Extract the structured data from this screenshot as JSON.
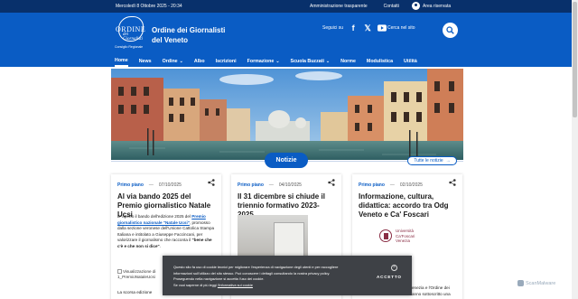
{
  "topbar": {
    "date": "Mercoledì 8 Ottobre 2025 - 20:34",
    "links": [
      "Amministrazione trasparente",
      "Contatti"
    ],
    "reserved_area": "Area riservata"
  },
  "header": {
    "logo_text_main": "ORDINE",
    "logo_text_sub": "dei Giornalisti",
    "logo_caption": "Consiglio Regionale",
    "title_line1": "Ordine dei Giornalisti",
    "title_line2": "del Veneto",
    "follow_label": "Seguici su",
    "search_label": "Cerca nel sito"
  },
  "nav": [
    {
      "label": "Home",
      "active": true,
      "dropdown": false
    },
    {
      "label": "News",
      "active": false,
      "dropdown": false
    },
    {
      "label": "Ordine",
      "active": false,
      "dropdown": true
    },
    {
      "label": "Albo",
      "active": false,
      "dropdown": false
    },
    {
      "label": "Iscrizioni",
      "active": false,
      "dropdown": false
    },
    {
      "label": "Formazione",
      "active": false,
      "dropdown": true
    },
    {
      "label": "Scuola Buzzati",
      "active": false,
      "dropdown": true
    },
    {
      "label": "Norme",
      "active": false,
      "dropdown": false
    },
    {
      "label": "Modulistica",
      "active": false,
      "dropdown": false
    },
    {
      "label": "Utilità",
      "active": false,
      "dropdown": false
    }
  ],
  "section": {
    "title": "Notizie",
    "all_link": "Tutte le notizie"
  },
  "cards": [
    {
      "category": "Primo piano",
      "date": "07/10/2025",
      "title": "Al via bando 2025 del Premio giornalistico Natale Ucsi",
      "body_1": "E' aperto il bando dell'edizione 2025 del ",
      "body_link": "Premio giornalistico nazionale \"Natale Ucsi\"",
      "body_2": ", promosso dalla sezione veronese dell'Unione Cattolica Stampa Italiana e intitolato a Giuseppe Faccincani, per valorizzare il giornalismo che racconta il ",
      "body_bold": "\"bene che c'è e che non si dice\"",
      "body_3": ".",
      "image_alt": "Visualizzazione di 1_PremioNataleUcsi",
      "footer": "La scorsa edizione"
    },
    {
      "category": "Primo piano",
      "date": "04/10/2025",
      "title": "Il 31 dicembre si chiude il triennio formativo 2023-2025"
    },
    {
      "category": "Primo piano",
      "date": "02/10/2025",
      "title": "Informazione, cultura, didattica: accordo tra Odg Veneto e Ca' Foscari",
      "logo_text_1": "Università",
      "logo_text_2": "Ca'Foscari",
      "logo_text_3": "Venezia",
      "partial_1": "enezia e l'Ordine dei",
      "partial_2": "anno sottoscritto una"
    }
  ],
  "cookie": {
    "line1": "Questo sito fa uso di cookie tecnici per migliorare l'esperienza di navigazione degli utenti e per raccogliere",
    "line2": "informazioni sull'utilizzo del sito stesso. Può conoscere i dettagli consultando la nostra privacy policy.",
    "line3": "Proseguendo nella navigazione si accetta l'uso dei cookie.",
    "line4_a": "Se vuoi saperne di più leggi ",
    "line4_link": "l'informativa sui cookie",
    "accept": "ACCETTO"
  },
  "watermark": "ScanMalware",
  "colors": {
    "primary": "#0a5cc4",
    "topbar": "#08306b",
    "cookie_bg": "#3e4146"
  }
}
